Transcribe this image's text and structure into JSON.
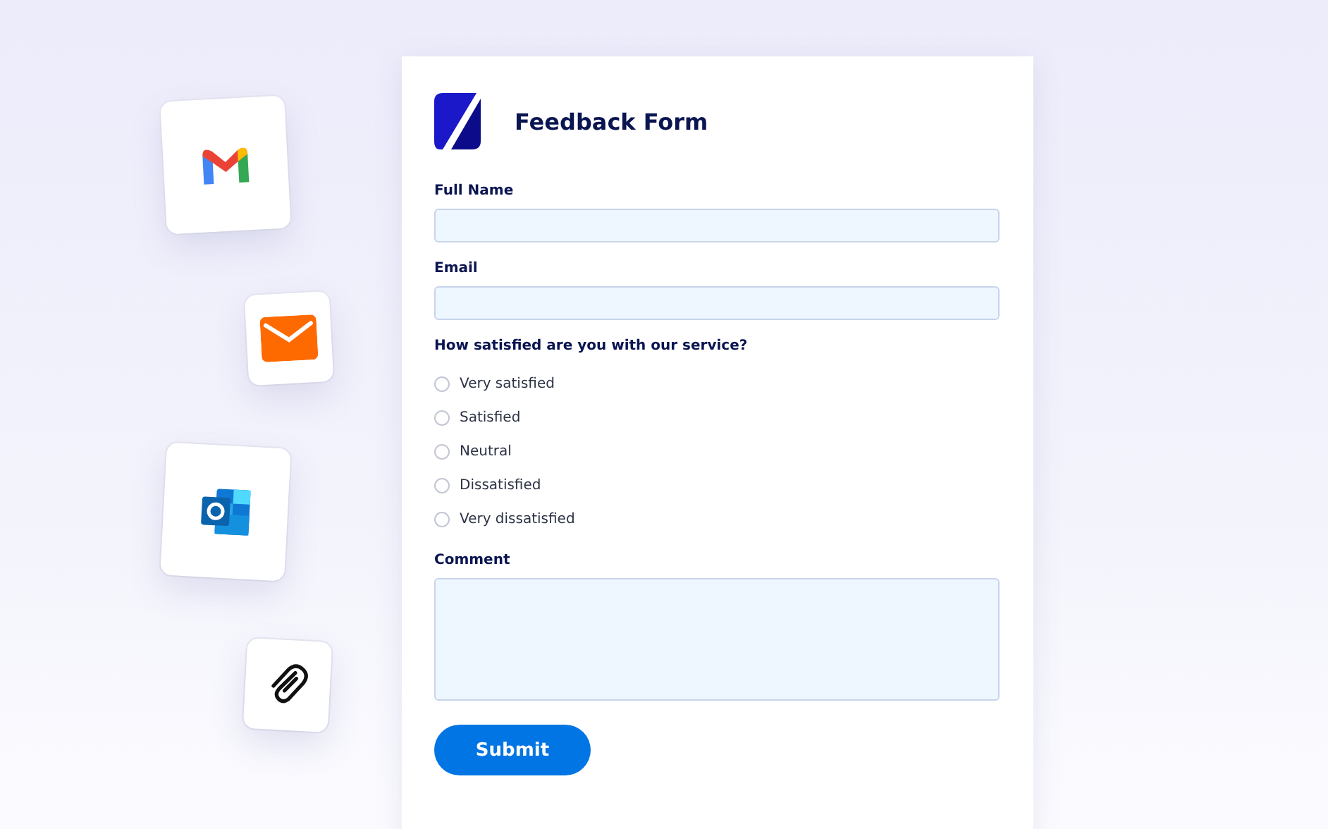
{
  "form": {
    "title": "Feedback Form",
    "fields": [
      {
        "kind": "input",
        "label": "Full Name"
      },
      {
        "kind": "input",
        "label": "Email"
      },
      {
        "kind": "radio",
        "label": "How satisfied are you with our service?",
        "options": [
          {
            "label": "Very satisfied",
            "selected": false
          },
          {
            "label": "Satisfied",
            "selected": false
          },
          {
            "label": "Neutral",
            "selected": false
          },
          {
            "label": "Dissatisfied",
            "selected": false
          },
          {
            "label": "Very dissatisfied",
            "selected": false
          }
        ]
      },
      {
        "kind": "textarea",
        "label": "Comment"
      }
    ],
    "submit": "Submit"
  },
  "integrations": [
    {
      "kind": "gmail"
    },
    {
      "kind": "mail"
    },
    {
      "kind": "outlook"
    },
    {
      "kind": "attachment"
    }
  ]
}
